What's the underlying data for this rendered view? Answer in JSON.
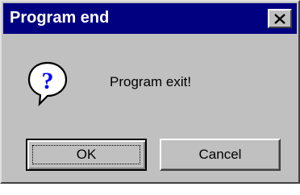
{
  "dialog": {
    "title": "Program end",
    "message": "Program exit!",
    "icon": "question-icon"
  },
  "buttons": {
    "ok_label": "OK",
    "cancel_label": "Cancel"
  },
  "titlebar": {
    "close_icon": "close-icon"
  },
  "colors": {
    "titlebar_bg": "#000080",
    "window_bg": "#c0c0c0",
    "question_mark": "#0000ff"
  }
}
